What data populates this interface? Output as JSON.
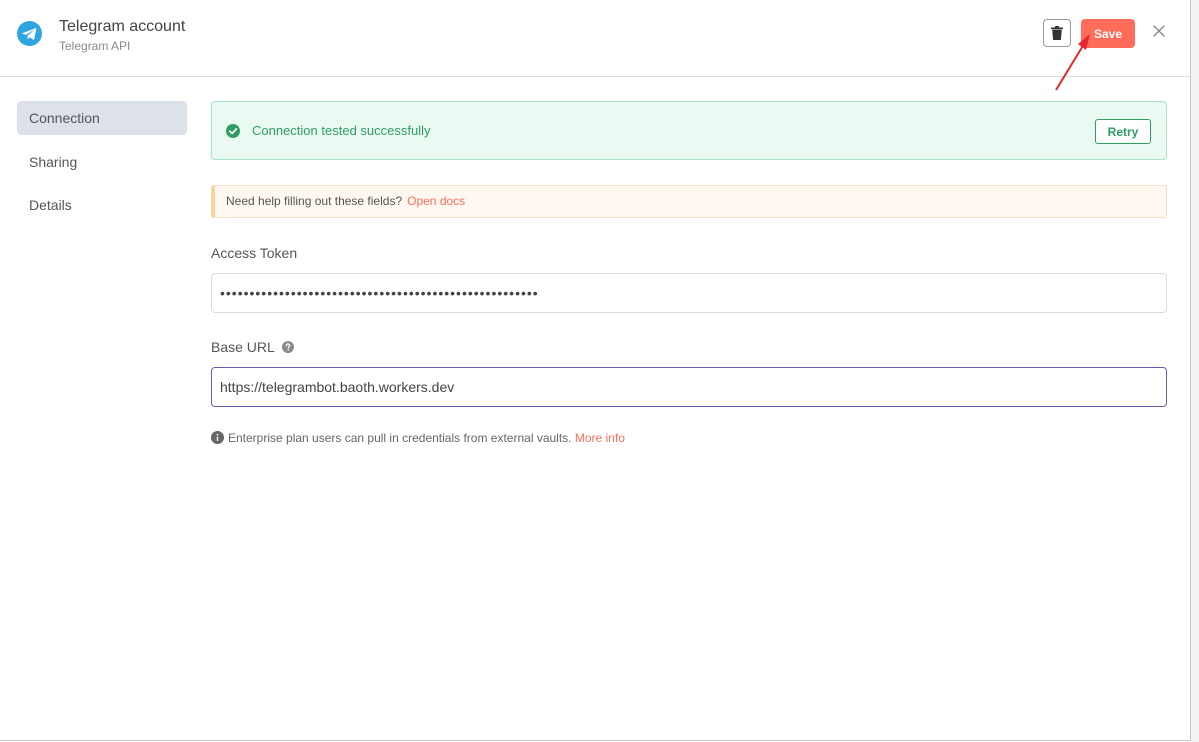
{
  "header": {
    "title": "Telegram account",
    "subtitle": "Telegram API",
    "save_label": "Save",
    "logo_icon": "telegram-logo-icon",
    "brand_color": "#2ca5e0",
    "accent_color": "#ff6d5a"
  },
  "sidebar": {
    "items": [
      {
        "label": "Connection",
        "active": true
      },
      {
        "label": "Sharing",
        "active": false
      },
      {
        "label": "Details",
        "active": false
      }
    ]
  },
  "status": {
    "message": "Connection tested successfully",
    "retry_label": "Retry",
    "color": "#2e9e62"
  },
  "help": {
    "text": "Need help filling out these fields?",
    "link": "Open docs"
  },
  "fields": {
    "access_token": {
      "label": "Access Token",
      "value": "••••••••••••••••••••••••••••••••••••••••••••••••••••••"
    },
    "base_url": {
      "label": "Base URL",
      "value": "https://telegrambot.baoth.workers.dev"
    }
  },
  "info": {
    "text": "Enterprise plan users can pull in credentials from external vaults.",
    "link": "More info"
  }
}
